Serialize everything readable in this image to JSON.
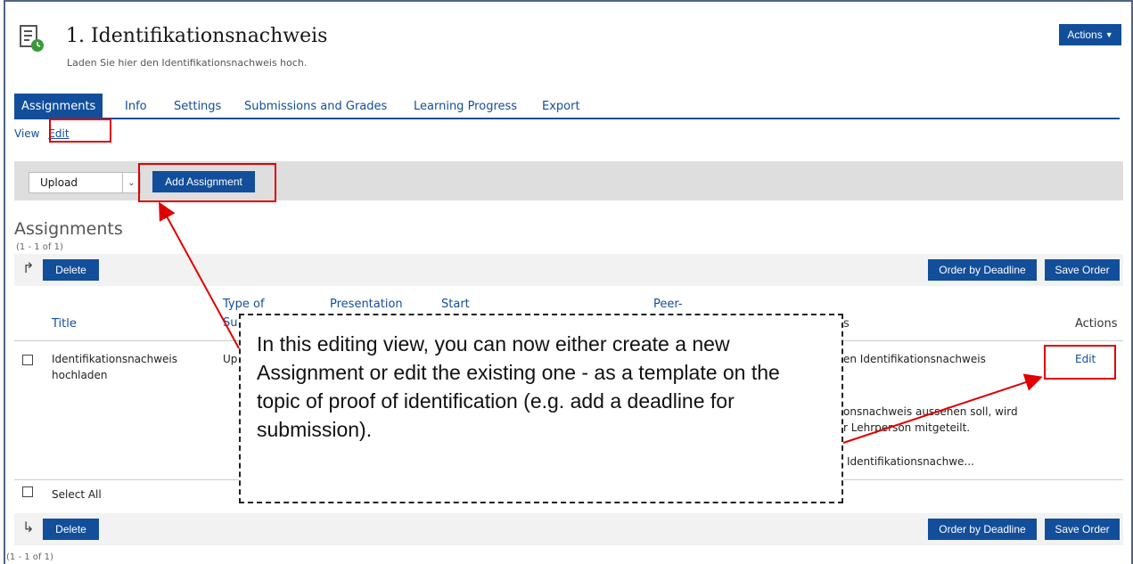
{
  "header": {
    "title": "1. Identifikationsnachweis",
    "subtitle": "Laden Sie hier den Identifikationsnachweis hoch.",
    "actions_label": "Actions"
  },
  "tabs": [
    {
      "label": "Assignments",
      "active": true
    },
    {
      "label": "Info"
    },
    {
      "label": "Settings"
    },
    {
      "label": "Submissions and Grades"
    },
    {
      "label": "Learning Progress"
    },
    {
      "label": "Export"
    }
  ],
  "subtabs": [
    "View",
    "Edit"
  ],
  "toolbar": {
    "select_value": "Upload",
    "add_label": "Add Assignment"
  },
  "list": {
    "title": "Assignments",
    "count_label": "(1 - 1 of 1)",
    "delete_label": "Delete",
    "order_label": "Order by Deadline",
    "save_label": "Save Order",
    "headers": {
      "title": "Title",
      "type_line1": "Type of",
      "type_line2": "Su",
      "presentation": "Presentation",
      "start": "Start",
      "peer": "Peer-",
      "s": "s",
      "actions": "Actions"
    },
    "row": {
      "title_line1": "Identifikationsnachweis",
      "title_line2": "hochladen",
      "type_partial": "Up",
      "desc_line1": "en Identifikationsnachweis",
      "desc_line2": "onsnachweis aussehen soll, wird",
      "desc_line3": "r Lehrperson mitgeteilt.",
      "desc_line4": "Identifikationsnachwe...",
      "edit_label": "Edit"
    },
    "select_all": "Select All"
  },
  "callout": {
    "text": "In this editing view, you can now either create a new Assignment or edit the existing one - as a template on the topic of proof of identification (e.g. add a deadline for submission)."
  },
  "colors": {
    "primary": "#124e9a",
    "highlight": "#e00000",
    "toolbar_bg": "#dedede"
  }
}
